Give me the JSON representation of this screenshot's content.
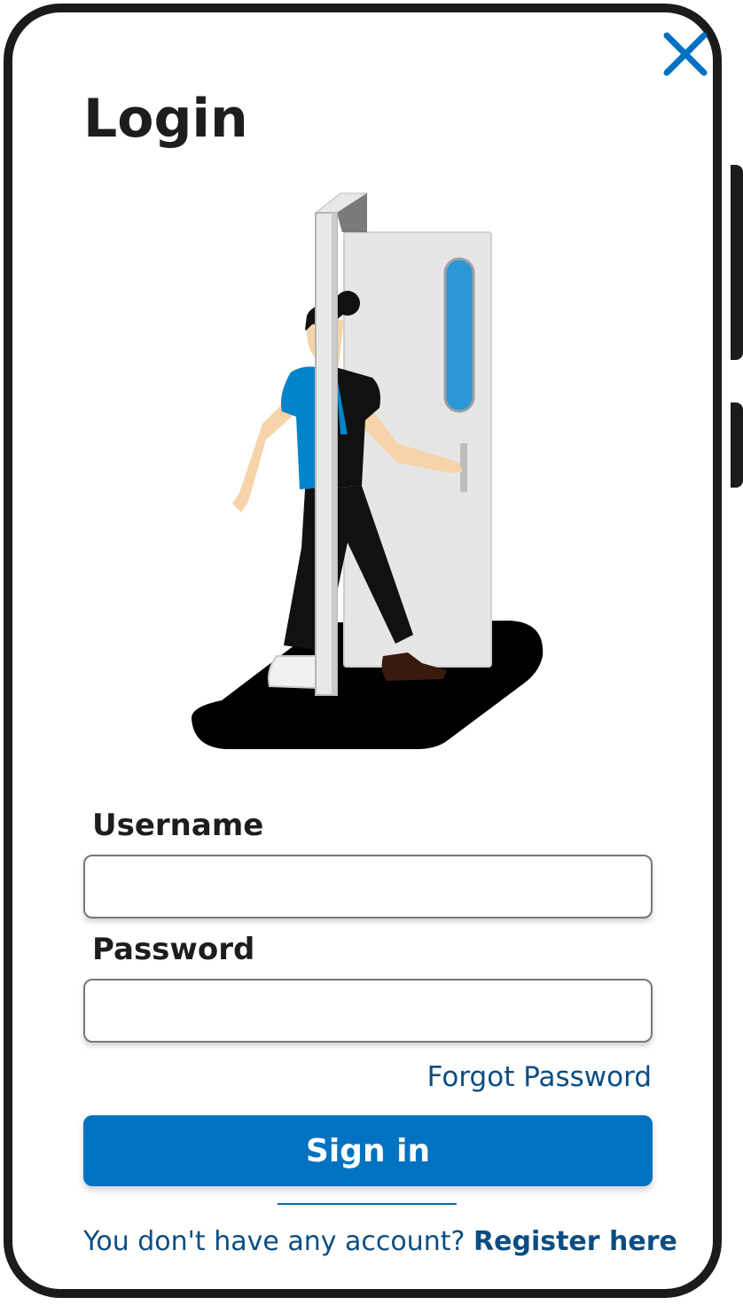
{
  "dialog": {
    "title": "Login",
    "close_icon": "close-icon",
    "illustration": "person-walking-through-door"
  },
  "form": {
    "username_label": "Username",
    "username_value": "",
    "password_label": "Password",
    "password_value": "",
    "forgot_password": "Forgot Password",
    "sign_in_label": "Sign in"
  },
  "footer": {
    "no_account_text": "You don't have any account?",
    "register_link": "Register here"
  },
  "colors": {
    "accent": "#0072c1",
    "link": "#0b4d82",
    "frame": "#1b1b1b"
  }
}
